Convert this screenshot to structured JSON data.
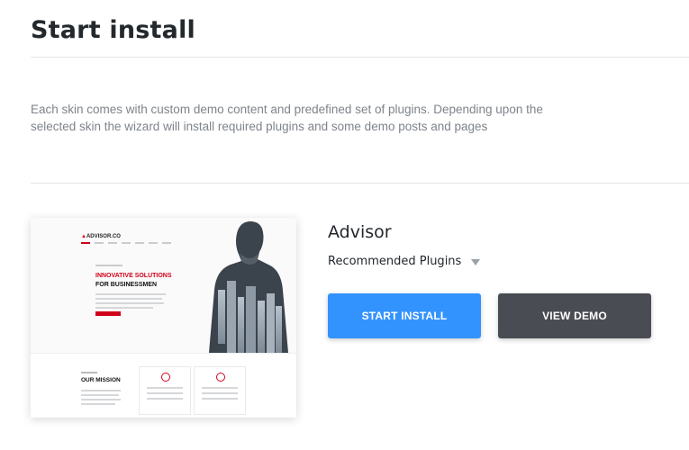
{
  "page": {
    "title": "Start install",
    "description": "Each skin comes with custom demo content and predefined set of plugins. Depending upon the selected skin the wizard will install required plugins and some demo posts and pages"
  },
  "skin": {
    "name": "Advisor",
    "recommended_label": "Recommended Plugins",
    "start_install_label": "START INSTALL",
    "view_demo_label": "VIEW DEMO",
    "preview": {
      "logo": "ADVISOR.CO",
      "headline_line1": "INNOVATIVE SOLUTIONS",
      "headline_line2": "FOR BUSINESSMEN",
      "mission_title": "OUR MISSION"
    }
  },
  "colors": {
    "primary_button": "#3393fe",
    "secondary_button": "#494c52",
    "preview_accent": "#d0021b"
  },
  "icons": {
    "recommended_toggle": "caret-down-icon"
  }
}
